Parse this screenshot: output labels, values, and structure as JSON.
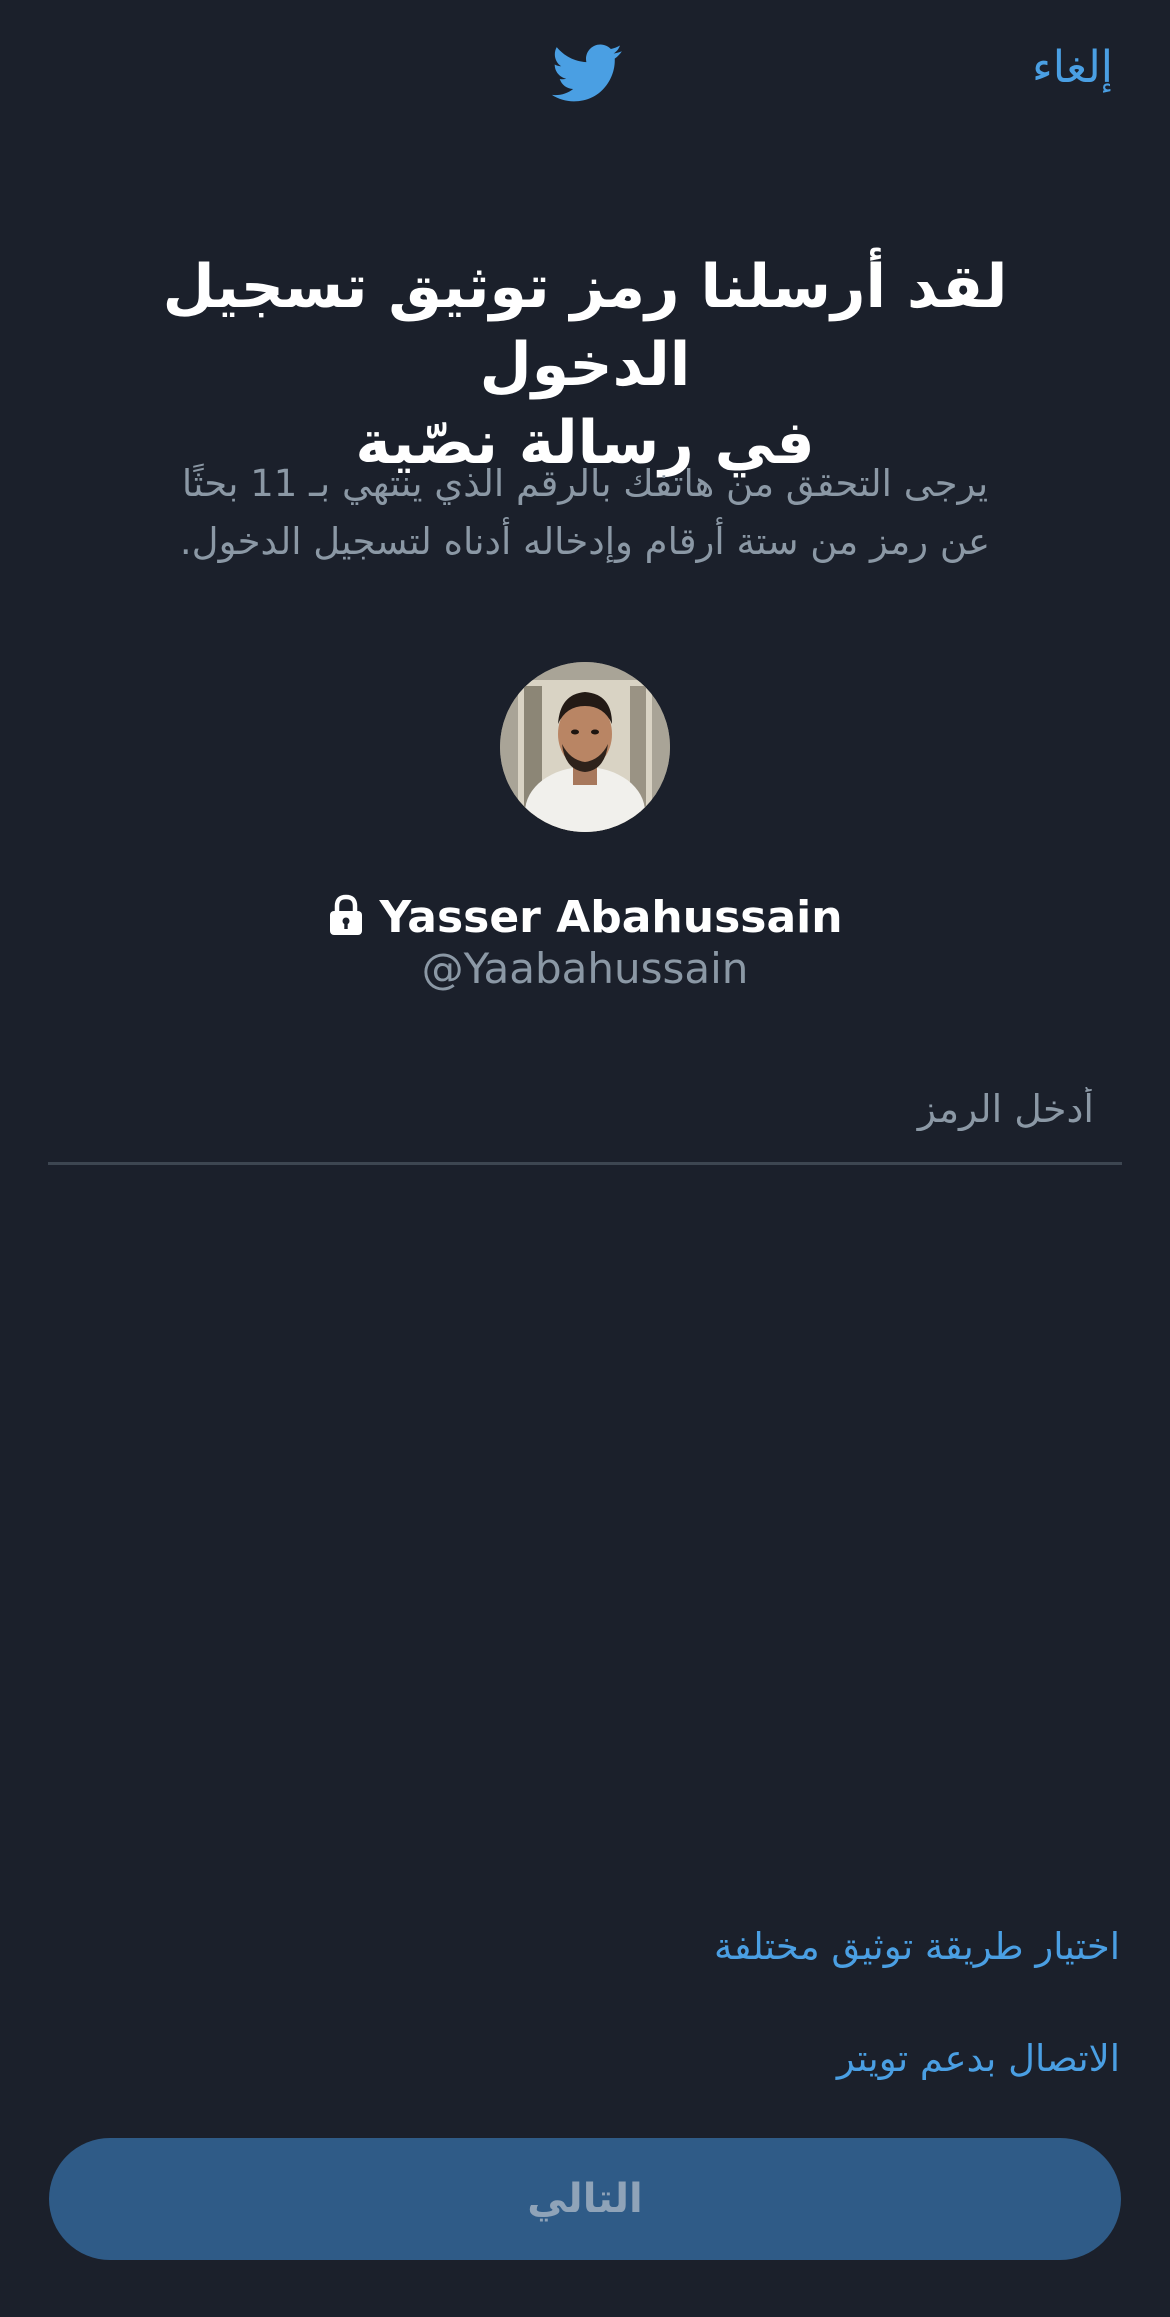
{
  "header": {
    "cancel_label": "إلغاء",
    "logo_icon": "twitter-bird-icon"
  },
  "main": {
    "title_line1": "لقد أرسلنا رمز توثيق تسجيل الدخول",
    "title_line2": "في رسالة نصّية",
    "subtitle_line1": "يرجى التحقق من هاتفك بالرقم الذي ينتهي بـ 11 بحثًا",
    "subtitle_line2": "عن رمز من ستة أرقام وإدخاله أدناه لتسجيل الدخول."
  },
  "user": {
    "name": "Yasser Abahussain",
    "handle": "@Yaabahussain",
    "protected_icon": "lock-icon"
  },
  "form": {
    "code_placeholder": "أدخل الرمز",
    "code_value": ""
  },
  "links": {
    "different_method": "اختيار طريقة توثيق مختلفة",
    "contact_support": "الاتصال بدعم تويتر"
  },
  "footer": {
    "next_label": "التالي"
  },
  "colors": {
    "background": "#1b202b",
    "accent": "#4a9fe3",
    "muted_text": "#8b98a5",
    "button_disabled": "#2f5b87"
  }
}
